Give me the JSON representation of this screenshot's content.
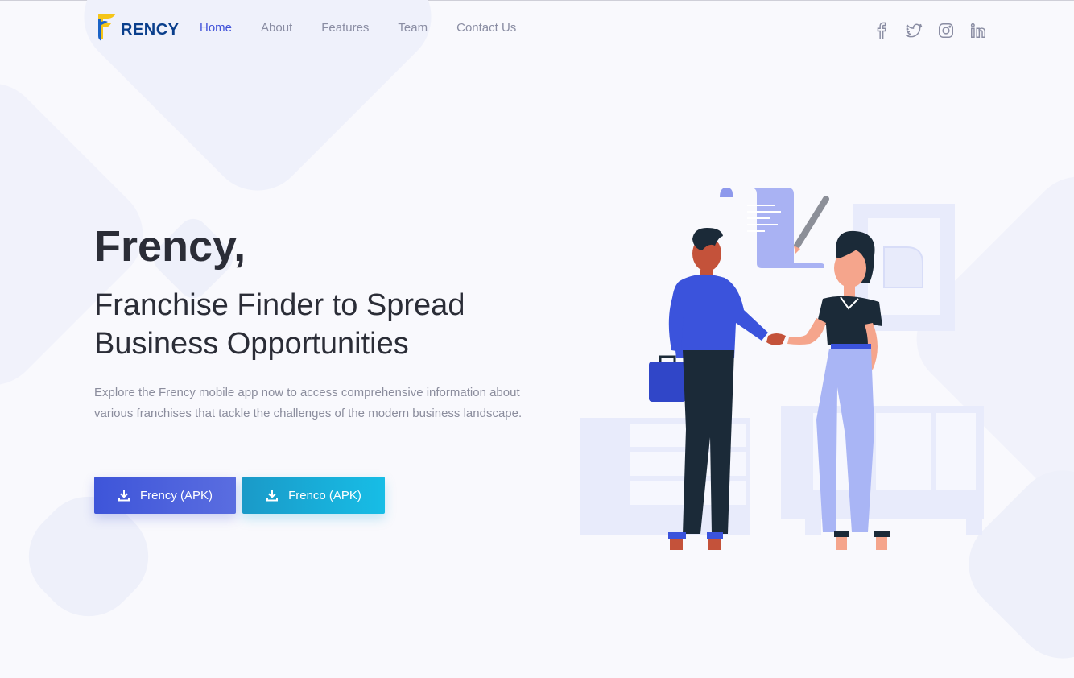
{
  "brand": {
    "name": "RENCY"
  },
  "nav": {
    "items": [
      {
        "label": "Home",
        "active": true
      },
      {
        "label": "About"
      },
      {
        "label": "Features"
      },
      {
        "label": "Team"
      },
      {
        "label": "Contact Us"
      }
    ]
  },
  "social": [
    "facebook-icon",
    "twitter-icon",
    "instagram-icon",
    "linkedin-icon"
  ],
  "hero": {
    "title": "Frency,",
    "subtitle": "Franchise Finder to Spread Business Opportunities",
    "description": "Explore the Frency mobile app now to access comprehensive information about various franchises that tackle the challenges of the modern business landscape."
  },
  "buttons": {
    "primary": "Frency (APK)",
    "secondary": "Frenco (APK)"
  },
  "colors": {
    "accent": "#4152d9",
    "cyan": "#17bde6",
    "brand_blue": "#0a3f8c",
    "brand_yellow": "#f5c518"
  }
}
